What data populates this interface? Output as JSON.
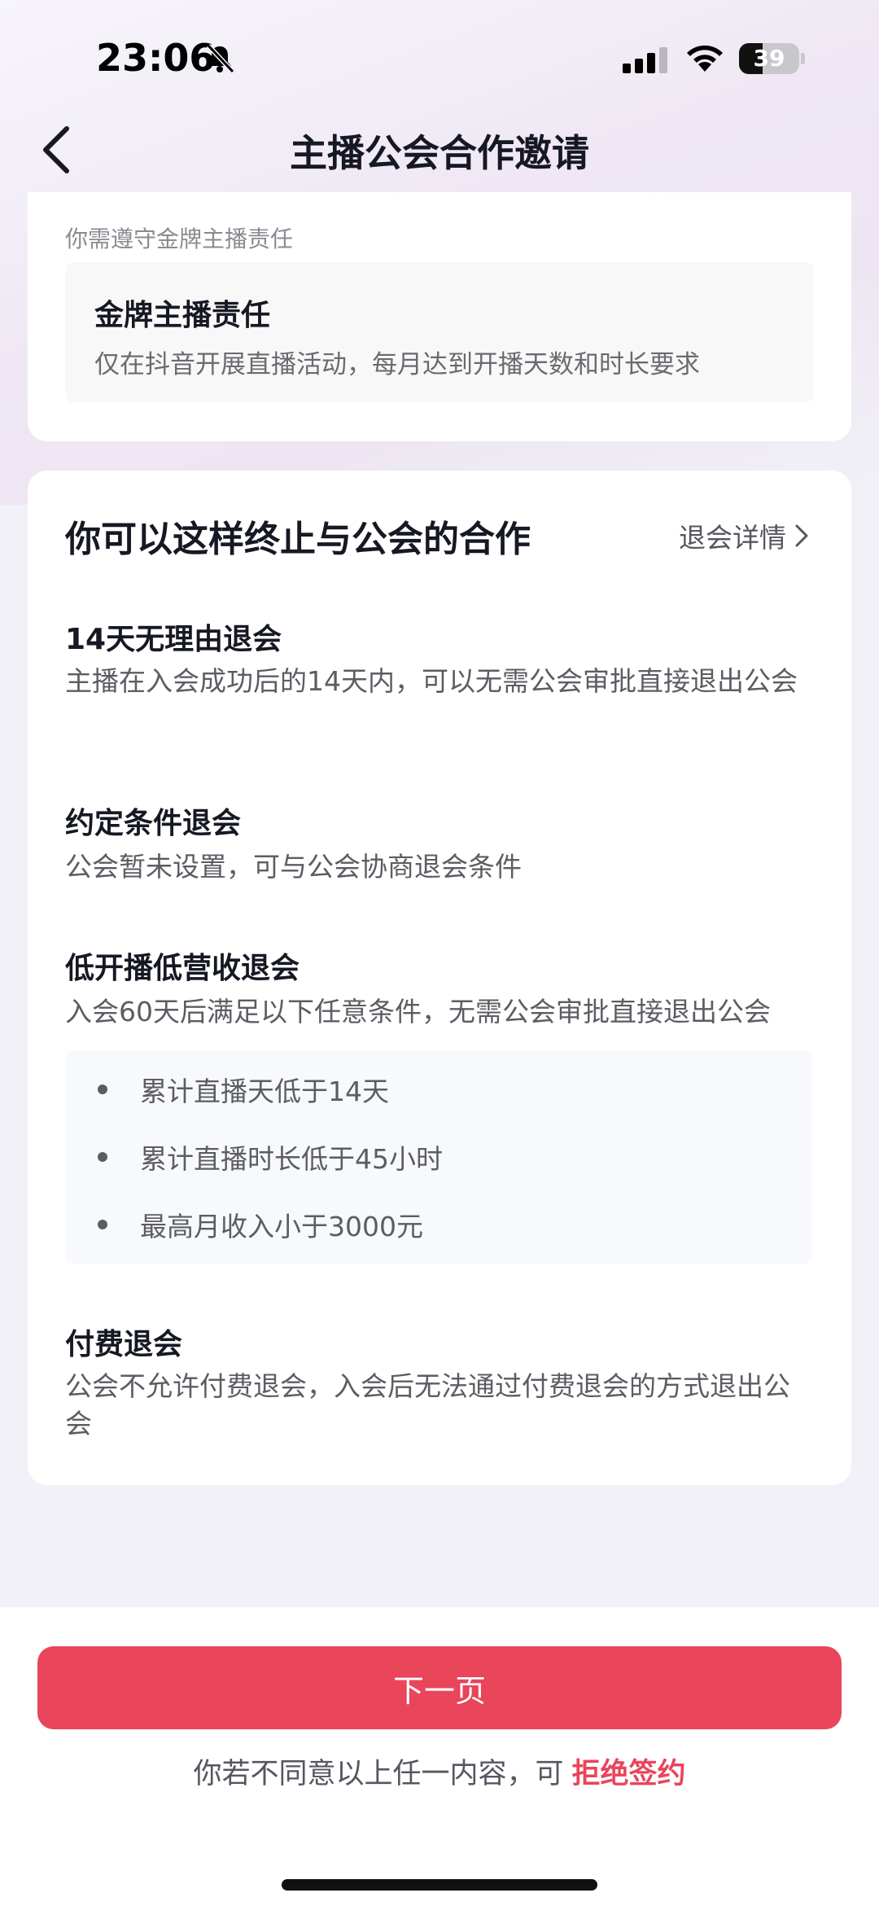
{
  "status_bar": {
    "time": "23:06",
    "battery_level": "39",
    "battery_fraction": 0.39,
    "icons": [
      "bell-muted-icon",
      "signal-icon",
      "wifi-icon",
      "battery-icon"
    ]
  },
  "nav": {
    "back_icon": "chevron-left-icon",
    "title": "主播公会合作邀请"
  },
  "duty_card": {
    "hint": "你需遵守金牌主播责任",
    "title": "金牌主播责任",
    "description": "仅在抖音开展直播活动，每月达到开播天数和时长要求"
  },
  "terminate_card": {
    "title": "你可以这样终止与公会的合作",
    "detail_link": "退会详情",
    "items": [
      {
        "title": "14天无理由退会",
        "description": "主播在入会成功后的14天内，可以无需公会审批直接退出公会"
      },
      {
        "title": "约定条件退会",
        "description": "公会暂未设置，可与公会协商退会条件"
      },
      {
        "title": "低开播低营收退会",
        "description": "入会60天后满足以下任意条件，无需公会审批直接退出公会",
        "conditions": [
          "累计直播天低于14天",
          "累计直播时长低于45小时",
          "最高月收入小于3000元"
        ]
      },
      {
        "title": "付费退会",
        "description": "公会不允许付费退会，入会后无法通过付费退会的方式退出公会"
      }
    ]
  },
  "bottom": {
    "next_label": "下一页",
    "decline_prefix": "你若不同意以上任一内容，可",
    "decline_link": "拒绝签约"
  },
  "colors": {
    "accent": "#e9455b",
    "background": "#f2f1f7",
    "card": "#ffffff"
  }
}
